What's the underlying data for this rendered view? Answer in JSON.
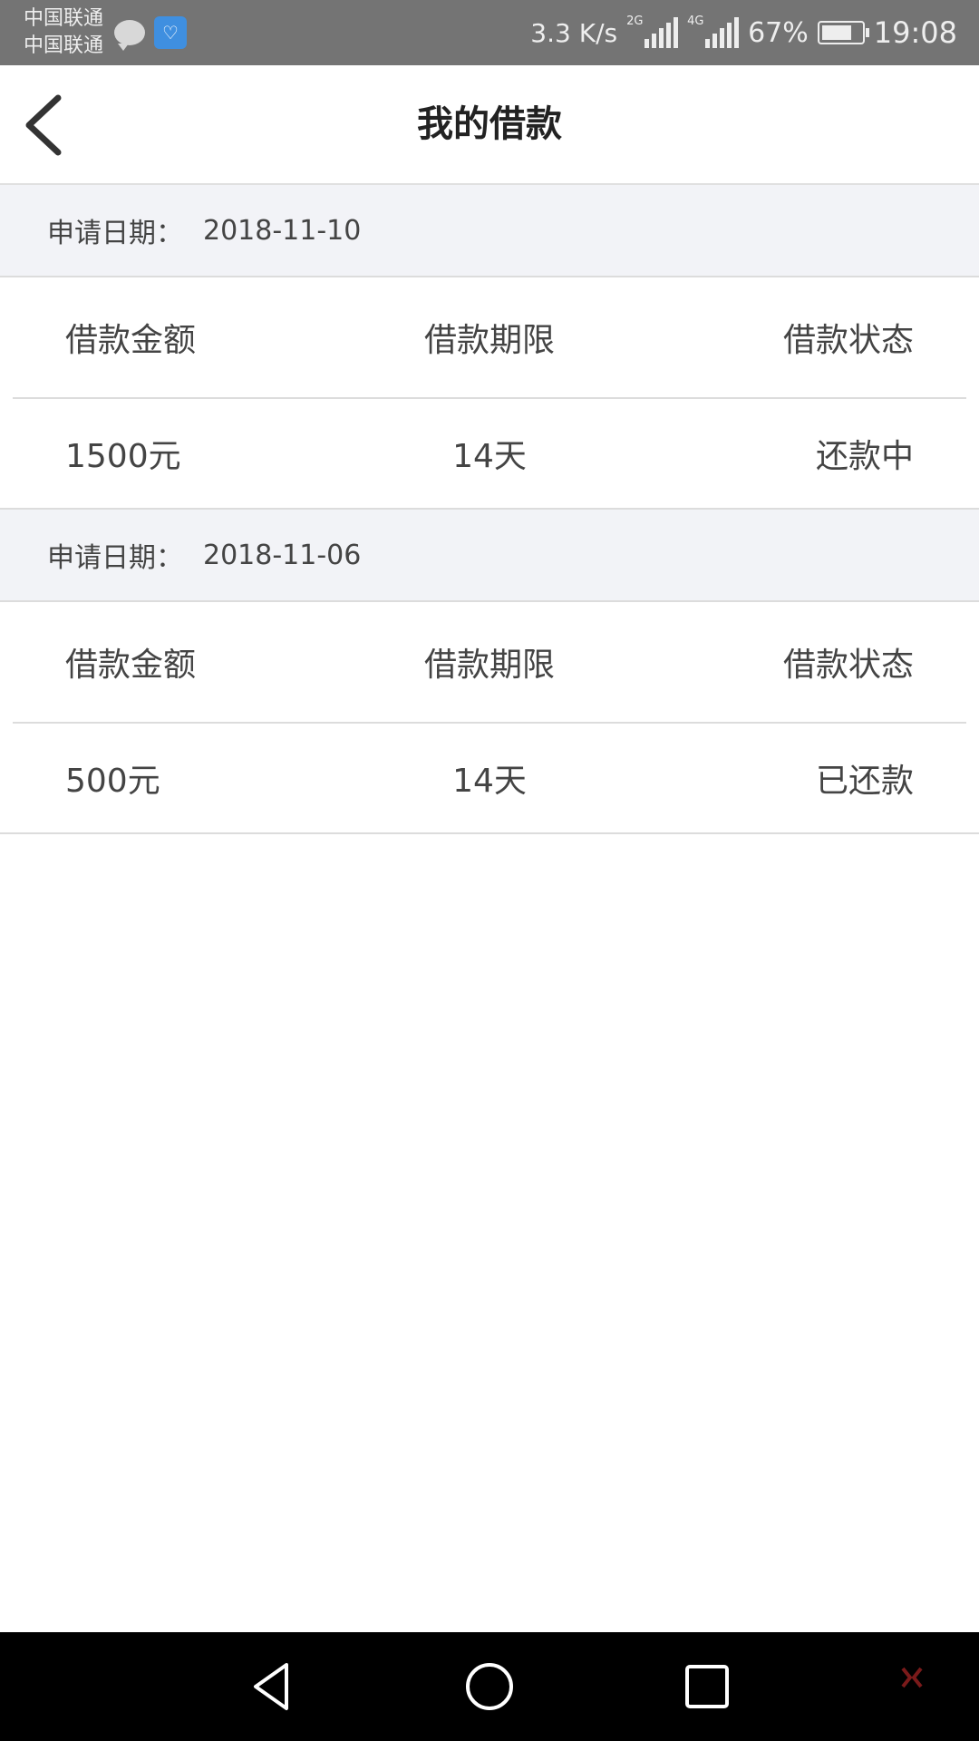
{
  "status_bar": {
    "carrier_1": "中国联通",
    "carrier_2": "中国联通",
    "net_speed": "3.3 K/s",
    "signal_1_label": "2G",
    "signal_2_label": "4G",
    "battery": "67%",
    "time": "19:08"
  },
  "header": {
    "title": "我的借款"
  },
  "loans": [
    {
      "date_label": "申请日期：",
      "date": "2018-11-10",
      "columns": [
        "借款金额",
        "借款期限",
        "借款状态"
      ],
      "amount": "1500元",
      "term": "14天",
      "status": "还款中"
    },
    {
      "date_label": "申请日期：",
      "date": "2018-11-06",
      "columns": [
        "借款金额",
        "借款期限",
        "借款状态"
      ],
      "amount": "500元",
      "term": "14天",
      "status": "已还款"
    }
  ],
  "colors": {
    "status_bar_bg": "#747474",
    "date_bar_bg": "#f2f3f7",
    "divider": "#dcdcdc",
    "nav_bar_bg": "#000000"
  }
}
